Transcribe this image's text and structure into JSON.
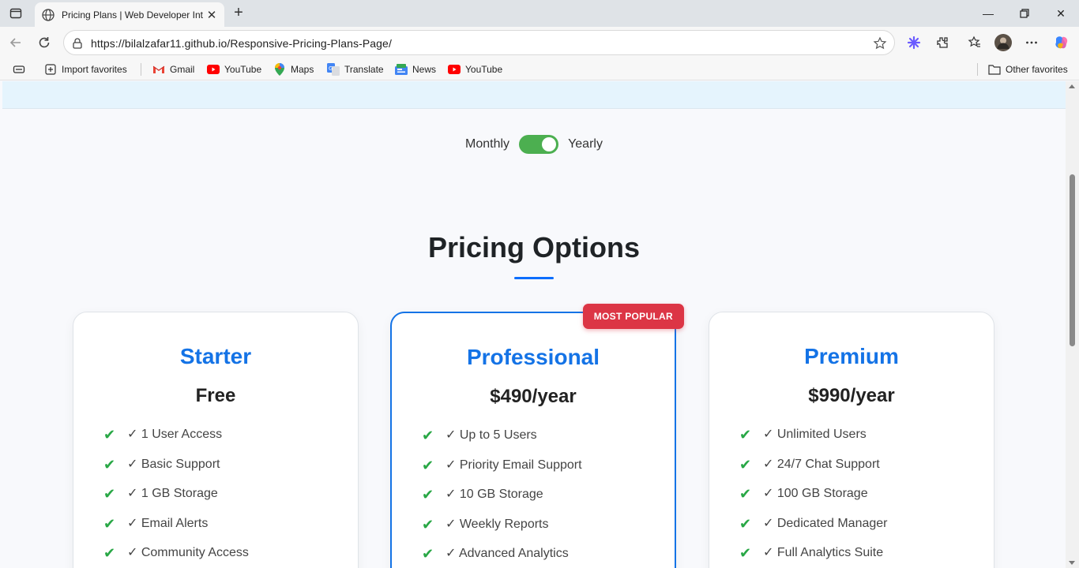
{
  "browser": {
    "tab_title": "Pricing Plans | Web Developer Int",
    "url": "https://bilalzafar11.github.io/Responsive-Pricing-Plans-Page/",
    "bookmarks": [
      {
        "label": "Import favorites",
        "icon": "import-icon"
      },
      {
        "label": "Gmail",
        "icon": "gmail-icon"
      },
      {
        "label": "YouTube",
        "icon": "youtube-icon"
      },
      {
        "label": "Maps",
        "icon": "maps-icon"
      },
      {
        "label": "Translate",
        "icon": "translate-icon"
      },
      {
        "label": "News",
        "icon": "news-icon"
      },
      {
        "label": "YouTube",
        "icon": "youtube-icon"
      }
    ],
    "other_favorites": "Other favorites"
  },
  "billing_toggle": {
    "left_label": "Monthly",
    "right_label": "Yearly",
    "state": "yearly"
  },
  "page": {
    "title": "Pricing Options"
  },
  "plans": [
    {
      "name": "Starter",
      "price": "Free",
      "features": [
        "✓ 1 User Access",
        "✓ Basic Support",
        "✓ 1 GB Storage",
        "✓ Email Alerts",
        "✓ Community Access"
      ]
    },
    {
      "name": "Professional",
      "price": "$490/year",
      "badge": "MOST POPULAR",
      "features": [
        "✓ Up to 5 Users",
        "✓ Priority Email Support",
        "✓ 10 GB Storage",
        "✓ Weekly Reports",
        "✓ Advanced Analytics"
      ]
    },
    {
      "name": "Premium",
      "price": "$990/year",
      "features": [
        "✓ Unlimited Users",
        "✓ 24/7 Chat Support",
        "✓ 100 GB Storage",
        "✓ Dedicated Manager",
        "✓ Full Analytics Suite"
      ]
    }
  ],
  "check_glyph": "✔",
  "colors": {
    "accent": "#1473e6",
    "check": "#28a745",
    "badge": "#dc3545",
    "toggle": "#4caf50"
  }
}
